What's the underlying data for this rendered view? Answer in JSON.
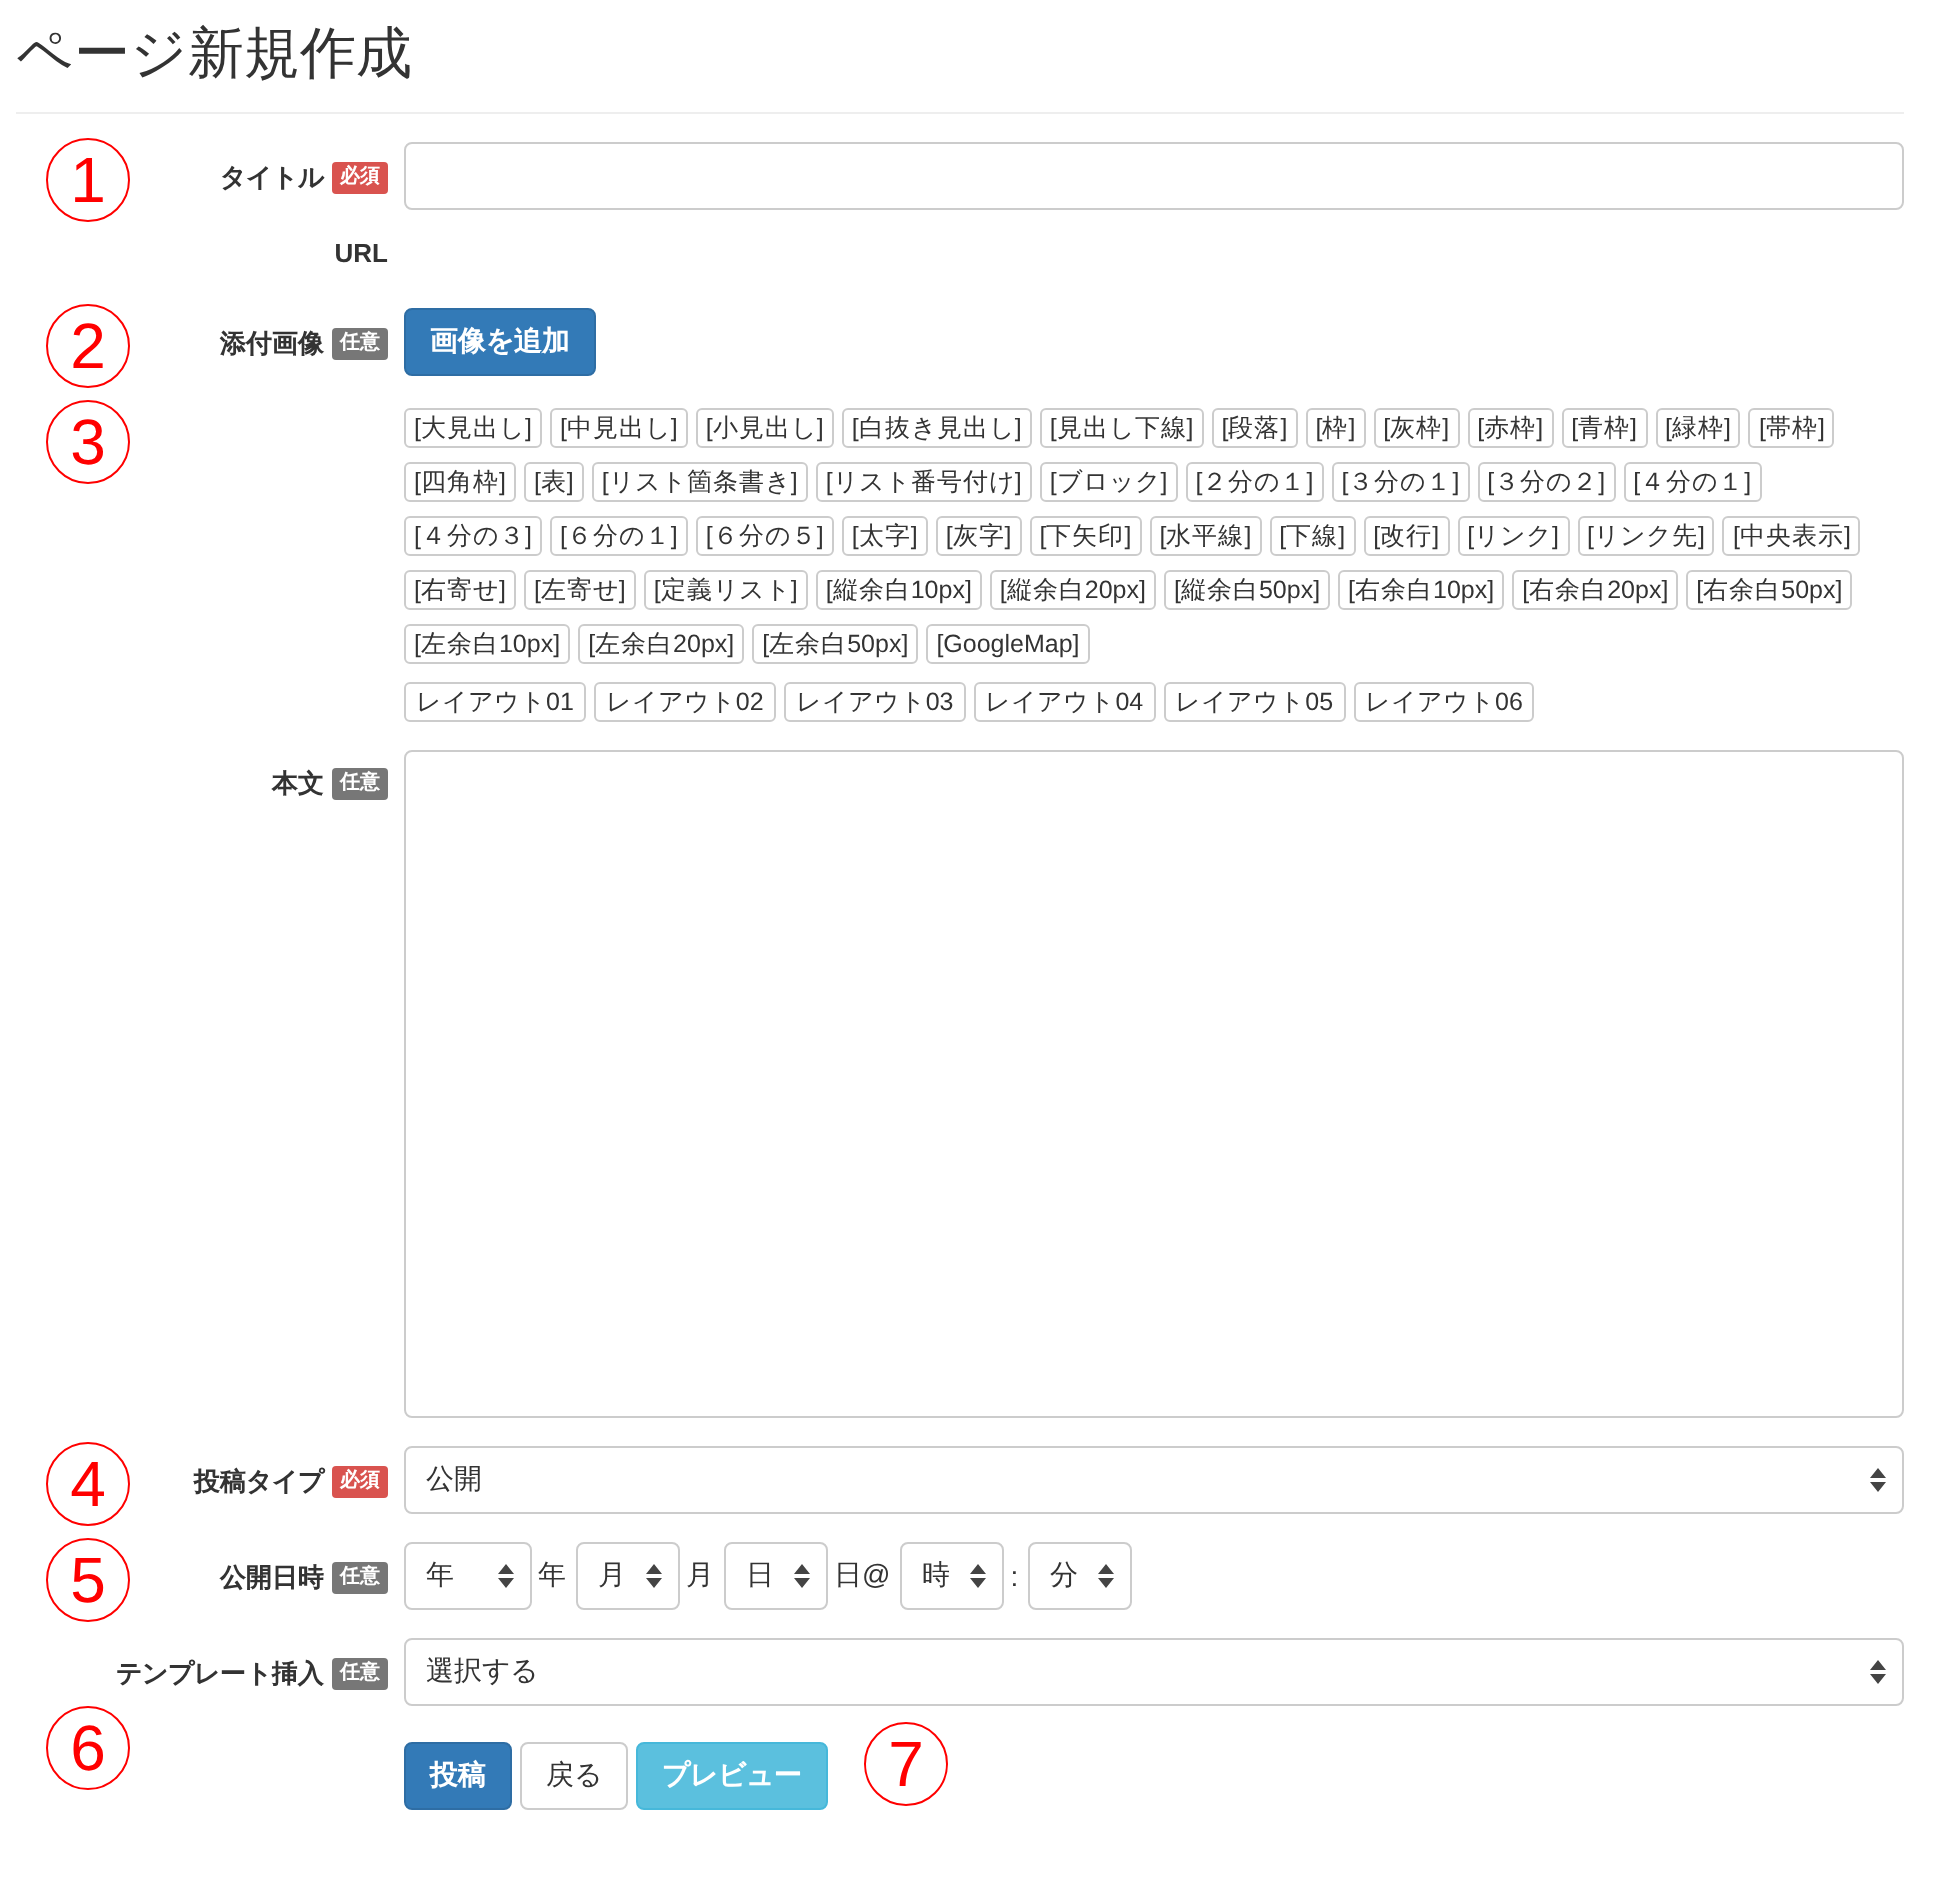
{
  "page_title": "ページ新規作成",
  "fields": [
    {
      "kind": "text",
      "marker": "1",
      "label": "タイトル",
      "badge": {
        "text": "必須",
        "required": true
      }
    },
    {
      "kind": "static",
      "label": "URL"
    },
    {
      "kind": "button",
      "marker": "2",
      "label": "添付画像",
      "badge": {
        "text": "任意",
        "required": false
      },
      "button": "画像を追加"
    },
    {
      "kind": "tags",
      "marker": "3",
      "tags": [
        "[大見出し]",
        "[中見出し]",
        "[小見出し]",
        "[白抜き見出し]",
        "[見出し下線]",
        "[段落]",
        "[枠]",
        "[灰枠]",
        "[赤枠]",
        "[青枠]",
        "[緑枠]",
        "[帯枠]",
        "[四角枠]",
        "[表]",
        "[リスト箇条書き]",
        "[リスト番号付け]",
        "[ブロック]",
        "[２分の１]",
        "[３分の１]",
        "[３分の２]",
        "[４分の１]",
        "[４分の３]",
        "[６分の１]",
        "[６分の５]",
        "[太字]",
        "[灰字]",
        "[下矢印]",
        "[水平線]",
        "[下線]",
        "[改行]",
        "[リンク]",
        "[リンク先]",
        "[中央表示]",
        "[右寄せ]",
        "[左寄せ]",
        "[定義リスト]",
        "[縦余白10px]",
        "[縦余白20px]",
        "[縦余白50px]",
        "[右余白10px]",
        "[右余白20px]",
        "[右余白50px]",
        "[左余白10px]",
        "[左余白20px]",
        "[左余白50px]",
        "[GoogleMap]"
      ],
      "layouts": [
        "レイアウト01",
        "レイアウト02",
        "レイアウト03",
        "レイアウト04",
        "レイアウト05",
        "レイアウト06"
      ]
    },
    {
      "kind": "textarea",
      "label": "本文",
      "badge": {
        "text": "任意",
        "required": false
      }
    },
    {
      "kind": "select",
      "marker": "4",
      "label": "投稿タイプ",
      "badge": {
        "text": "必須",
        "required": true
      },
      "value": "公開"
    },
    {
      "kind": "datetime",
      "marker": "5",
      "label": "公開日時",
      "badge": {
        "text": "任意",
        "required": false
      },
      "parts": [
        {
          "value": "年",
          "suffix": "年"
        },
        {
          "value": "月",
          "suffix": "月"
        },
        {
          "value": "日",
          "suffix": "日@"
        },
        {
          "value": "時",
          "suffix": ":"
        },
        {
          "value": "分"
        }
      ]
    },
    {
      "kind": "select",
      "label": "テンプレート挿入",
      "badge": {
        "text": "任意",
        "required": false
      },
      "value": "選択する"
    },
    {
      "kind": "actions",
      "marker": "6",
      "buttons": [
        {
          "text": "投稿",
          "kind": "primary"
        },
        {
          "text": "戻る",
          "kind": "default"
        },
        {
          "text": "プレビュー",
          "kind": "info"
        }
      ],
      "after_marker": "7"
    }
  ]
}
